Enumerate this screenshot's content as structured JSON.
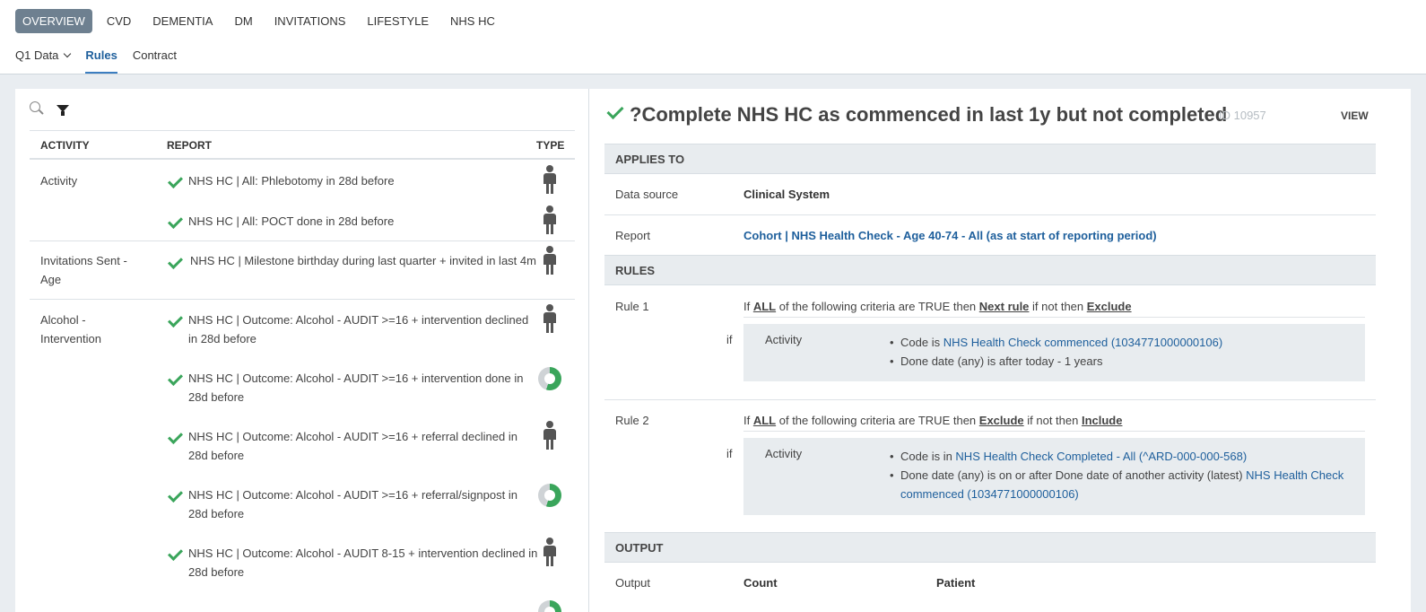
{
  "nav": {
    "tabs": [
      "OVERVIEW",
      "CVD",
      "DEMENTIA",
      "DM",
      "INVITATIONS",
      "LIFESTYLE",
      "NHS HC"
    ],
    "active_tab": "OVERVIEW",
    "sub": {
      "dropdown": "Q1 Data",
      "rules": "Rules",
      "contract": "Contract"
    }
  },
  "table": {
    "headers": {
      "activity": "ACTIVITY",
      "report": "REPORT",
      "type": "TYPE"
    },
    "groups": [
      {
        "label": "Activity",
        "rows": [
          {
            "text": "NHS HC | All: Phlebotomy in 28d before",
            "type": "person"
          },
          {
            "text": "NHS HC | All: POCT done in 28d before",
            "type": "person"
          }
        ]
      },
      {
        "label": "Invitations Sent - Age",
        "rows": [
          {
            "text": "NHS HC | Milestone birthday during last quarter + invited in last 4m",
            "type": "person"
          }
        ]
      },
      {
        "label": "Alcohol - Intervention",
        "rows": [
          {
            "text": "NHS HC | Outcome: Alcohol - AUDIT >=16 + intervention declined in 28d before",
            "type": "person"
          },
          {
            "text": "NHS HC | Outcome: Alcohol - AUDIT >=16 + intervention done in 28d before",
            "type": "donut"
          },
          {
            "text": "NHS HC | Outcome: Alcohol - AUDIT >=16 + referral declined in 28d before",
            "type": "person"
          },
          {
            "text": "NHS HC | Outcome: Alcohol - AUDIT >=16 + referral/signpost in 28d before",
            "type": "donut"
          },
          {
            "text": "NHS HC | Outcome: Alcohol - AUDIT 8-15 + intervention declined in 28d before",
            "type": "person"
          }
        ]
      }
    ]
  },
  "detail": {
    "title": "?Complete NHS HC as commenced in last 1y but not completed",
    "id": "ID 10957",
    "view": "VIEW",
    "applies_to": "APPLIES TO",
    "data_source_label": "Data source",
    "data_source_value": "Clinical System",
    "report_label": "Report",
    "report_value": "Cohort | NHS Health Check - Age 40-74 - All (as at start of reporting period)",
    "rules_header": "RULES",
    "if_word": "if",
    "rule1": {
      "name": "Rule 1",
      "p1": "If ",
      "all": "ALL",
      "p2": " of the following criteria are TRUE then ",
      "then": "Next rule",
      "p3": " if not then ",
      "else": "Exclude",
      "crit_type": "Activity",
      "c1_text": "Code is ",
      "c1_link": "NHS Health Check commenced (1034771000000106)",
      "c2_text": "Done date (any) is after today - 1 years"
    },
    "rule2": {
      "name": "Rule 2",
      "p1": "If ",
      "all": "ALL",
      "p2": " of the following criteria are TRUE then ",
      "then": "Exclude",
      "p3": " if not then ",
      "else": "Include",
      "crit_type": "Activity",
      "c1_text": "Code is in ",
      "c1_link": "NHS Health Check Completed - All (^ARD-000-000-568)",
      "c2_text": "Done date (any) is on or after Done date of another activity (latest) ",
      "c2_link": "NHS Health Check commenced (1034771000000106)"
    },
    "output_header": "OUTPUT",
    "output_label": "Output",
    "output_count": "Count",
    "output_patient": "Patient"
  }
}
